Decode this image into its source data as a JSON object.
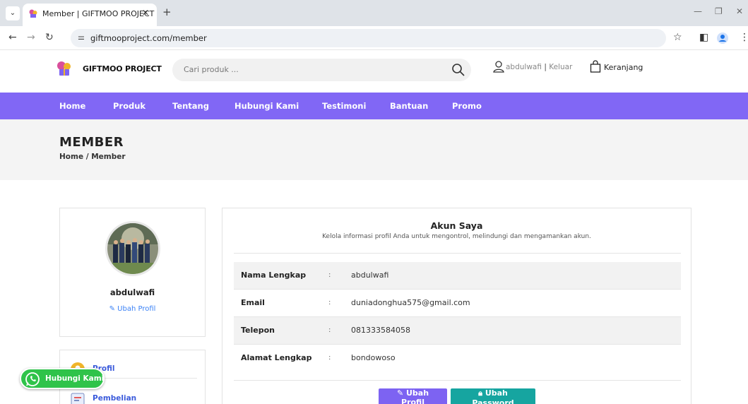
{
  "browser": {
    "tab_title": "Member | GIFTMOO PROJECT",
    "tab_close": "✕",
    "new_tab": "+",
    "url": "giftmooproject.com/member"
  },
  "site": {
    "brand": "GIFTMOO PROJECT",
    "search_placeholder": "Cari produk ...",
    "user": "abdulwafi",
    "separator": "|",
    "logout": "Keluar",
    "cart": "Keranjang"
  },
  "nav": [
    "Home",
    "Produk",
    "Tentang",
    "Hubungi Kami",
    "Testimoni",
    "Bantuan",
    "Promo"
  ],
  "page": {
    "title": "MEMBER",
    "breadcrumb": "Home / Member"
  },
  "profile": {
    "username": "abdulwafi",
    "edit_label": "Ubah Profil"
  },
  "side_menu": [
    "Profil",
    "Pembelian"
  ],
  "whatsapp": {
    "label": "Hubungi Kami"
  },
  "account": {
    "title": "Akun Saya",
    "subtitle": "Kelola informasi profil Anda untuk mengontrol, melindungi dan mengamankan akun.",
    "colon": ":",
    "rows": [
      {
        "label": "Nama Lengkap",
        "value": "abdulwafi"
      },
      {
        "label": "Email",
        "value": "duniadonghua575@gmail.com"
      },
      {
        "label": "Telepon",
        "value": "081333584058"
      },
      {
        "label": "Alamat Lengkap",
        "value": "bondowoso"
      }
    ],
    "btn_edit_profile": "Ubah Profil",
    "btn_edit_password": "Ubah Password"
  },
  "colors": {
    "nav_purple": "#8167f5",
    "button_purple": "#7d63f2",
    "button_teal": "#16a5a0",
    "whatsapp_green": "#2fc34a",
    "link_blue": "#3b82f6"
  }
}
